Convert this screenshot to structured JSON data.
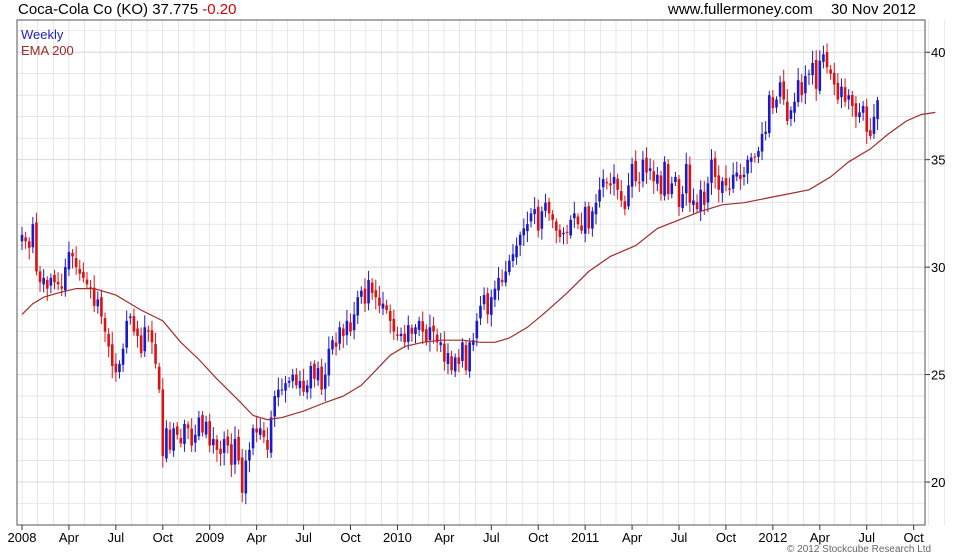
{
  "header": {
    "symbol": "Coca-Cola Co (KO) 37.775",
    "change": "-0.20",
    "site": "www.fullermoney.com",
    "date": "30 Nov 2012"
  },
  "legend": {
    "weekly": "Weekly",
    "ema": "EMA 200"
  },
  "footer": {
    "copyright": "© 2012 Stockcube Research Ltd"
  },
  "colors": {
    "up": "#1a1acc",
    "down": "#dd1111",
    "ema": "#a52a2a",
    "grid": "#d8d8d8",
    "frame": "#555555"
  },
  "chart_data": {
    "type": "candlestick",
    "ylim": [
      18,
      41.5
    ],
    "y_ticks": [
      20,
      25,
      30,
      35,
      40
    ],
    "x_ticks": [
      {
        "label": "2008",
        "week": 0
      },
      {
        "label": "Apr",
        "week": 13
      },
      {
        "label": "Jul",
        "week": 26
      },
      {
        "label": "Oct",
        "week": 39
      },
      {
        "label": "2009",
        "week": 52
      },
      {
        "label": "Apr",
        "week": 65
      },
      {
        "label": "Jul",
        "week": 78
      },
      {
        "label": "Oct",
        "week": 91
      },
      {
        "label": "2010",
        "week": 104
      },
      {
        "label": "Apr",
        "week": 117
      },
      {
        "label": "Jul",
        "week": 130
      },
      {
        "label": "Oct",
        "week": 143
      },
      {
        "label": "2011",
        "week": 156
      },
      {
        "label": "Apr",
        "week": 169
      },
      {
        "label": "Jul",
        "week": 182
      },
      {
        "label": "Oct",
        "week": 195
      },
      {
        "label": "2012",
        "week": 208
      },
      {
        "label": "Apr",
        "week": 221
      },
      {
        "label": "Jul",
        "week": 234
      },
      {
        "label": "Oct",
        "week": 247
      }
    ],
    "closes": [
      31.5,
      31.2,
      30.9,
      32.0,
      29.8,
      29.3,
      29.5,
      29.0,
      29.5,
      29.3,
      29.2,
      29.0,
      30.0,
      30.7,
      30.5,
      30.0,
      29.7,
      29.5,
      29.2,
      29.0,
      28.2,
      28.5,
      27.7,
      27.0,
      26.3,
      25.4,
      25.1,
      25.5,
      26.2,
      27.5,
      27.7,
      27.0,
      26.8,
      26.0,
      27.2,
      27.0,
      26.5,
      25.5,
      24.3,
      21.2,
      22.5,
      21.5,
      22.5,
      22.2,
      21.8,
      22.7,
      22.5,
      21.7,
      22.2,
      23.0,
      22.3,
      22.8,
      21.7,
      22.0,
      21.5,
      21.3,
      22.0,
      21.7,
      20.8,
      22.0,
      21.0,
      19.5,
      21.0,
      21.5,
      22.5,
      22.3,
      22.5,
      22.1,
      21.5,
      23.0,
      24.0,
      24.3,
      24.3,
      24.6,
      24.7,
      25.0,
      24.5,
      24.7,
      24.2,
      24.5,
      25.4,
      24.8,
      25.3,
      24.3,
      25.0,
      26.2,
      26.6,
      26.3,
      27.2,
      26.8,
      27.5,
      27.0,
      27.8,
      28.6,
      28.9,
      28.3,
      29.4,
      28.8,
      28.6,
      28.2,
      28.3,
      28.0,
      27.5,
      27.0,
      26.8,
      26.9,
      26.5,
      27.3,
      26.9,
      27.2,
      27.5,
      27.0,
      26.5,
      27.2,
      27.0,
      26.5,
      26.5,
      25.6,
      26.0,
      25.2,
      25.8,
      25.5,
      26.5,
      25.2,
      26.5,
      26.6,
      27.5,
      28.2,
      28.7,
      27.8,
      28.6,
      29.0,
      29.5,
      29.3,
      29.8,
      30.3,
      30.6,
      31.0,
      31.5,
      31.8,
      32.0,
      32.5,
      32.7,
      31.7,
      32.6,
      33.0,
      32.5,
      32.2,
      31.7,
      31.4,
      31.6,
      31.6,
      32.2,
      32.5,
      32.0,
      31.7,
      32.8,
      31.8,
      32.6,
      33.0,
      33.6,
      34.1,
      33.9,
      33.8,
      34.2,
      33.6,
      33.1,
      32.7,
      33.8,
      34.8,
      34.0,
      33.9,
      35.0,
      34.4,
      34.6,
      34.0,
      34.3,
      33.4,
      34.9,
      33.4,
      33.9,
      34.2,
      32.8,
      33.4,
      34.8,
      33.0,
      33.1,
      32.7,
      33.6,
      32.9,
      33.9,
      35.0,
      34.2,
      33.6,
      34.0,
      33.8,
      33.6,
      34.3,
      34.4,
      34.1,
      34.3,
      35.0,
      35.1,
      35.1,
      35.4,
      36.2,
      36.3,
      38.0,
      37.4,
      37.8,
      38.6,
      37.8,
      36.8,
      37.3,
      37.7,
      38.7,
      38.0,
      38.9,
      39.0,
      39.5,
      38.3,
      39.6,
      39.9,
      39.3,
      39.0,
      38.5,
      37.8,
      38.4,
      37.7,
      38.0,
      37.5,
      37.0,
      37.2,
      37.5,
      36.3,
      36.1,
      37.0,
      37.77
    ],
    "ema": [
      [
        0,
        27.8
      ],
      [
        3,
        28.3
      ],
      [
        6,
        28.6
      ],
      [
        10,
        28.8
      ],
      [
        15,
        29.0
      ],
      [
        20,
        29.0
      ],
      [
        26,
        28.7
      ],
      [
        33,
        28.0
      ],
      [
        39,
        27.5
      ],
      [
        44,
        26.5
      ],
      [
        49,
        25.7
      ],
      [
        54,
        24.8
      ],
      [
        60,
        23.8
      ],
      [
        64,
        23.1
      ],
      [
        68,
        22.9
      ],
      [
        72,
        23.0
      ],
      [
        78,
        23.3
      ],
      [
        84,
        23.7
      ],
      [
        89,
        24.0
      ],
      [
        94,
        24.5
      ],
      [
        98,
        25.2
      ],
      [
        102,
        25.9
      ],
      [
        106,
        26.3
      ],
      [
        111,
        26.5
      ],
      [
        116,
        26.6
      ],
      [
        122,
        26.6
      ],
      [
        127,
        26.5
      ],
      [
        131,
        26.5
      ],
      [
        135,
        26.7
      ],
      [
        140,
        27.2
      ],
      [
        145,
        27.9
      ],
      [
        151,
        28.8
      ],
      [
        157,
        29.8
      ],
      [
        163,
        30.5
      ],
      [
        170,
        31.0
      ],
      [
        176,
        31.8
      ],
      [
        182,
        32.2
      ],
      [
        188,
        32.6
      ],
      [
        194,
        32.9
      ],
      [
        200,
        33.0
      ],
      [
        206,
        33.2
      ],
      [
        212,
        33.4
      ],
      [
        218,
        33.6
      ],
      [
        224,
        34.2
      ],
      [
        229,
        34.9
      ],
      [
        235,
        35.5
      ],
      [
        240,
        36.2
      ],
      [
        245,
        36.8
      ],
      [
        249,
        37.1
      ],
      [
        253,
        37.2
      ]
    ]
  }
}
